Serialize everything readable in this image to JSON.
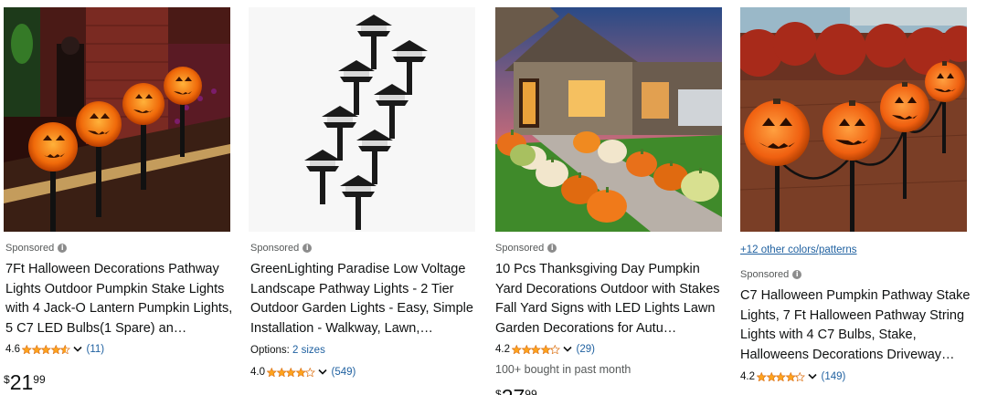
{
  "products": [
    {
      "sponsored": "Sponsored",
      "title": "7Ft Halloween Decorations Pathway Lights Outdoor Pumpkin Stake Lights with 4 Jack-O Lantern Pumpkin Lights, 5 C7 LED Bulbs(1 Spare) an…",
      "rating": "4.6",
      "rating_value": 4.6,
      "review_count": "(11)",
      "price_symbol": "$",
      "price_whole": "21",
      "price_fraction": "99"
    },
    {
      "sponsored": "Sponsored",
      "title": "GreenLighting Paradise Low Voltage Landscape Pathway Lights - 2 Tier Outdoor Garden Lights - Easy, Simple Installation - Walkway, Lawn,…",
      "options_label": "Options:",
      "options_link": "2 sizes",
      "rating": "4.0",
      "rating_value": 4.0,
      "review_count": "(549)"
    },
    {
      "sponsored": "Sponsored",
      "title": "10 Pcs Thanksgiving Day Pumpkin Yard Decorations Outdoor with Stakes Fall Yard Signs with LED Lights Lawn Garden Decorations for Autu…",
      "rating": "4.2",
      "rating_value": 4.2,
      "review_count": "(29)",
      "bought": "100+ bought in past month",
      "price_symbol": "$",
      "price_whole": "27",
      "price_fraction": "99"
    },
    {
      "colors_link": "+12 other colors/patterns",
      "sponsored": "Sponsored",
      "title": "C7 Halloween Pumpkin Pathway Stake Lights, 7 Ft Halloween Pathway String Lights with 4 C7 Bulbs, Stake, Halloweens Decorations Driveway…",
      "rating": "4.2",
      "rating_value": 4.2,
      "review_count": "(149)"
    }
  ],
  "colors": {
    "star": "#ffa41c",
    "link": "#2162a1",
    "muted": "#565959"
  }
}
